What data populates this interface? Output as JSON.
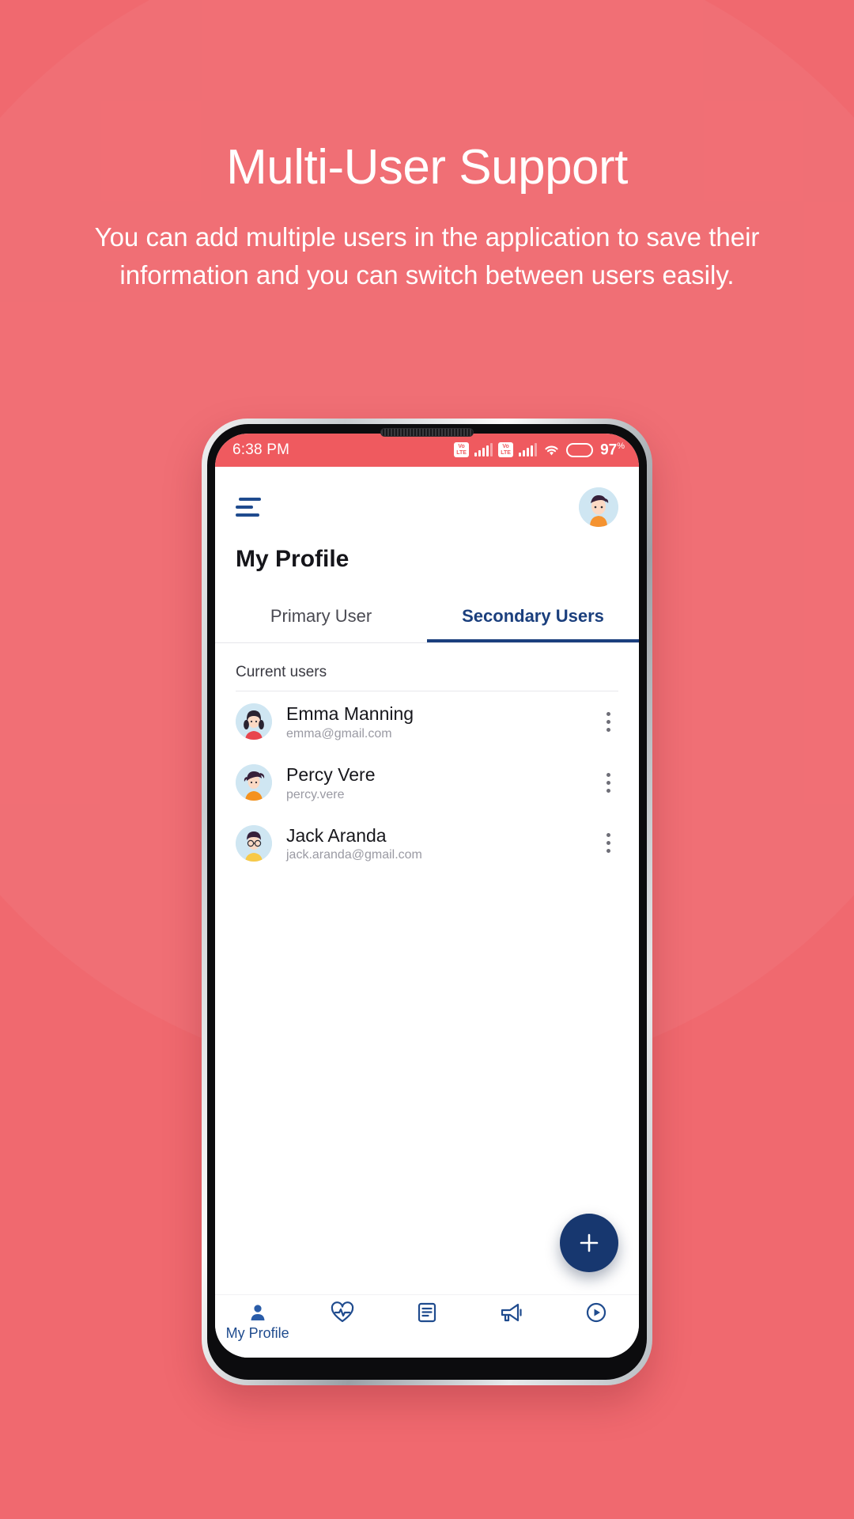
{
  "promo": {
    "title": "Multi-User Support",
    "description": "You can add multiple users in the application to save their information and you can switch between users easily."
  },
  "theme": {
    "background": "#f0696f",
    "status_bar": "#ef5a5f",
    "accent_blue": "#1b3f7d",
    "fab_blue": "#17376f",
    "nav_blue": "#1f4b8e"
  },
  "status_bar": {
    "time": "6:38 PM",
    "network_1": "VoLTE",
    "network_2": "VoLTE",
    "wifi_icon": "wifi-icon",
    "battery_icon": "battery-icon",
    "battery_percent": "97",
    "battery_unit": "%"
  },
  "app_header": {
    "menu_icon": "hamburger-menu-icon",
    "avatar_icon": "user-avatar",
    "page_title": "My Profile"
  },
  "tabs": [
    {
      "label": "Primary User",
      "active": false
    },
    {
      "label": "Secondary Users",
      "active": true
    }
  ],
  "list": {
    "section_label": "Current users",
    "users": [
      {
        "name": "Emma Manning",
        "email": "emma@gmail.com",
        "avatar": "female-avatar-dark-hair",
        "menu_icon": "more-vertical-icon"
      },
      {
        "name": "Percy Vere",
        "email": "percy.vere",
        "avatar": "male-avatar-spiky-hair",
        "menu_icon": "more-vertical-icon"
      },
      {
        "name": "Jack Aranda",
        "email": "jack.aranda@gmail.com",
        "avatar": "male-avatar-glasses",
        "menu_icon": "more-vertical-icon"
      }
    ]
  },
  "fab": {
    "icon": "plus-icon",
    "label": "+"
  },
  "bottom_nav": [
    {
      "icon": "person-icon",
      "label": "My Profile",
      "active": true
    },
    {
      "icon": "heart-pulse-icon",
      "label": "",
      "active": false
    },
    {
      "icon": "document-list-icon",
      "label": "",
      "active": false
    },
    {
      "icon": "megaphone-icon",
      "label": "",
      "active": false
    },
    {
      "icon": "play-circle-icon",
      "label": "",
      "active": false
    }
  ]
}
